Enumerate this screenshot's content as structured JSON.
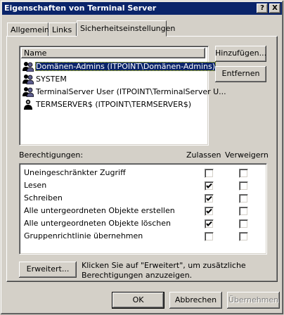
{
  "window": {
    "title": "Eigenschaften von Terminal Server",
    "help_button": "?",
    "close_button": "X"
  },
  "tabs": [
    {
      "label": "Allgemein",
      "active": false
    },
    {
      "label": "Links",
      "active": false
    },
    {
      "label": "Sicherheitseinstellungen",
      "active": true
    }
  ],
  "principals": {
    "column_header": "Name",
    "items": [
      {
        "name": "Domänen-Admins (ITPOINT\\Domänen-Admins)",
        "icon": "group-icon",
        "selected": true
      },
      {
        "name": "SYSTEM",
        "icon": "group-icon",
        "selected": false
      },
      {
        "name": "TerminalServer User (ITPOINT\\TerminalServer U...",
        "icon": "group-icon",
        "selected": false
      },
      {
        "name": "TERMSERVER$ (ITPOINT\\TERMSERVER$)",
        "icon": "user-icon",
        "selected": false
      }
    ]
  },
  "buttons": {
    "add": "Hinzufügen...",
    "remove": "Entfernen",
    "advanced": "Erweitert...",
    "ok": "OK",
    "cancel": "Abbrechen",
    "apply": "Übernehmen"
  },
  "permissions": {
    "label": "Berechtigungen:",
    "allow_header": "Zulassen",
    "deny_header": "Verweigern",
    "rows": [
      {
        "name": "Uneingeschränkter Zugriff",
        "allow": false,
        "deny": false
      },
      {
        "name": "Lesen",
        "allow": true,
        "deny": false
      },
      {
        "name": "Schreiben",
        "allow": true,
        "deny": false
      },
      {
        "name": "Alle untergeordneten Objekte erstellen",
        "allow": true,
        "deny": false
      },
      {
        "name": "Alle untergeordneten Objekte löschen",
        "allow": true,
        "deny": false
      },
      {
        "name": "Gruppenrichtlinie übernehmen",
        "allow": false,
        "deny": false
      }
    ]
  },
  "advanced_hint": {
    "line1": "Klicken Sie auf \"Erweitert\", um zusätzliche",
    "line2": "Berechtigungen anzuzeigen."
  }
}
